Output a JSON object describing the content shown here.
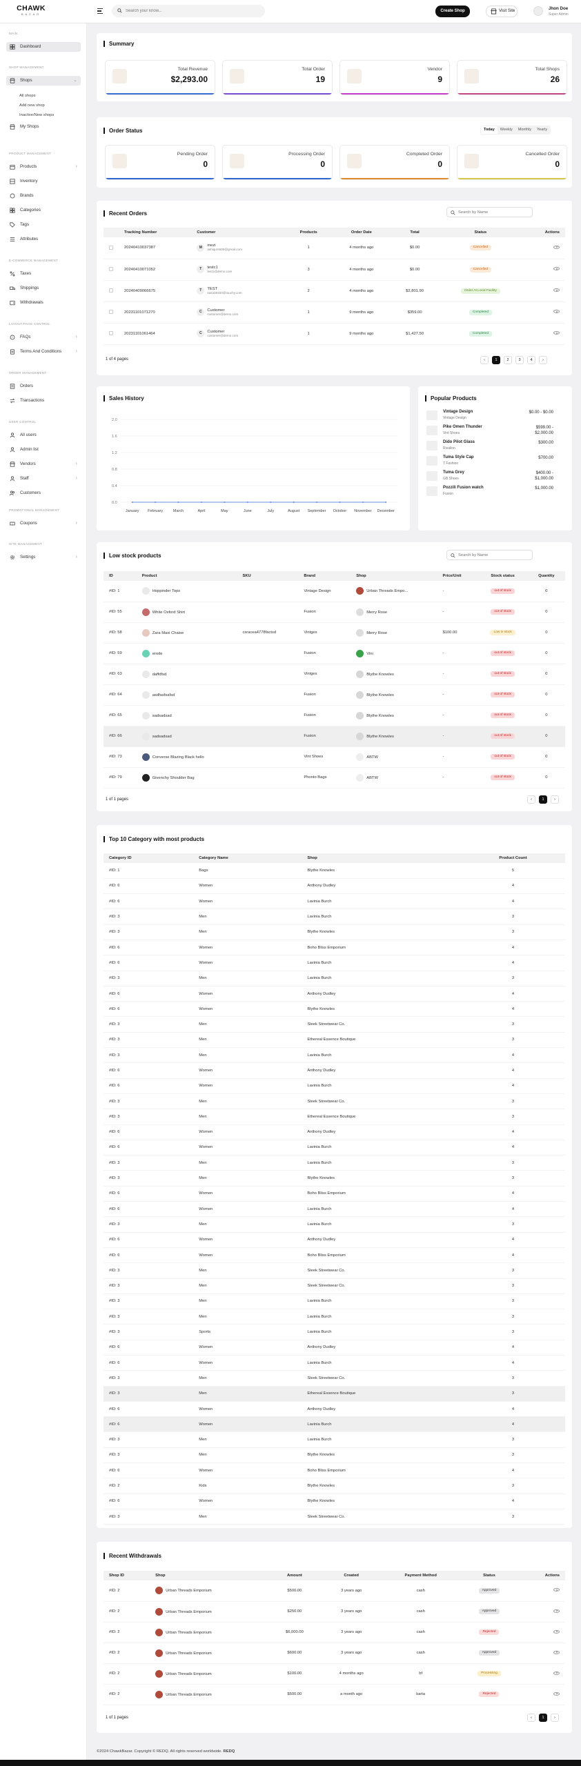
{
  "brand": {
    "name": "CHAWK",
    "tagline": "BAZAR"
  },
  "topbar": {
    "search_placeholder": "Search your know...",
    "create_shop": "Create Shop",
    "visit_site": "Visit Site",
    "user_name": "Jhon Doe",
    "user_role": "Super Admin"
  },
  "sidebar": {
    "sec_main": "MAIN",
    "dashboard": "Dashboard",
    "sec_shop": "SHOP MANAGEMENT",
    "shops": "Shops",
    "all_shops": "All shops",
    "add_new_shop": "Add new shop",
    "inactive_shops": "Inactive/New shops",
    "my_shops": "My Shops",
    "sec_product": "PRODUCT MANAGEMENT",
    "products": "Products",
    "inventory": "Inventory",
    "brands": "Brands",
    "categories": "Categories",
    "tags": "Tags",
    "attributes": "Attributes",
    "sec_ecom": "E-COMMERCE MANAGEMENT",
    "taxes": "Taxes",
    "shippings": "Shippings",
    "withdrawals": "Withdrawals",
    "sec_layout": "LAYOUT/PAGE CONTROL",
    "faqs": "FAQs",
    "terms": "Terms And Conditions",
    "sec_order": "ORDER MANAGEMENT",
    "orders": "Orders",
    "transactions": "Transactions",
    "sec_user": "USER CONTROL",
    "all_users": "All users",
    "admin_list": "Admin list",
    "vendors": "Vendors",
    "staff": "Staff",
    "customers": "Customers",
    "sec_promo": "PROMOTIONAL MANAGEMENT",
    "coupons": "Coupons",
    "sec_site": "SITE MANAGEMENT",
    "settings": "Settings"
  },
  "summary": {
    "title": "Summary",
    "cards": [
      {
        "label": "Total Revenue",
        "value": "$2,293.00",
        "color": "#3b6fd6"
      },
      {
        "label": "Total Order",
        "value": "19",
        "color": "#7b4fd6"
      },
      {
        "label": "Vendor",
        "value": "9",
        "color": "#c83fc9"
      },
      {
        "label": "Total Shops",
        "value": "26",
        "color": "#c64a8a"
      }
    ]
  },
  "order_status": {
    "title": "Order Status",
    "tabs": [
      "Today",
      "Weekly",
      "Monthly",
      "Yearly"
    ],
    "cards": [
      {
        "label": "Pending Order",
        "value": "0",
        "color": "#2f66d0"
      },
      {
        "label": "Processing Order",
        "value": "0",
        "color": "#2f66d0"
      },
      {
        "label": "Completed Order",
        "value": "0",
        "color": "#e08a2c"
      },
      {
        "label": "Cancelled Order",
        "value": "0",
        "color": "#d8c94a"
      }
    ]
  },
  "recent_orders": {
    "title": "Recent Orders",
    "search_placeholder": "Search by Name",
    "headers": [
      "Tracking Number",
      "Customer",
      "Products",
      "Order Date",
      "Total",
      "Status",
      "Actions"
    ],
    "rows": [
      {
        "tracking": "20240410037387",
        "initial": "M",
        "name": "mezi",
        "email": "ashiqurs500@gmail.com",
        "products": "1",
        "date": "4 months ago",
        "total": "$0.00",
        "status": "Cancelled",
        "st": "cancel"
      },
      {
        "tracking": "20240410071052",
        "initial": "T",
        "name": "testc1",
        "email": "test1@demo.com",
        "products": "3",
        "date": "4 months ago",
        "total": "$0.00",
        "status": "Cancelled",
        "st": "cancel"
      },
      {
        "tracking": "20240409066675",
        "initial": "T",
        "name": "TEST",
        "email": "sasa35320@touchy.com",
        "products": "2",
        "date": "4 months ago",
        "total": "$2,801.90",
        "status": "Order At Local Facility",
        "st": "atlocal"
      },
      {
        "tracking": "20231101071270",
        "initial": "C",
        "name": "Customer",
        "email": "customer@demo.com",
        "products": "1",
        "date": "9 months ago",
        "total": "$359.00",
        "status": "Completed",
        "st": "complete"
      },
      {
        "tracking": "20231101061464",
        "initial": "C",
        "name": "Customer",
        "email": "customer@demo.com",
        "products": "1",
        "date": "9 months ago",
        "total": "$1,427.50",
        "status": "Completed",
        "st": "complete"
      }
    ],
    "pages_text": "1 of 4 pages",
    "pages": [
      "1",
      "2",
      "3",
      "4"
    ]
  },
  "sales_history": {
    "title": "Sales History"
  },
  "chart_data": {
    "type": "line",
    "title": "Sales History",
    "categories": [
      "January",
      "February",
      "March",
      "April",
      "May",
      "June",
      "July",
      "August",
      "September",
      "October",
      "November",
      "December"
    ],
    "series": [
      {
        "values": [
          0,
          0,
          0,
          0,
          0,
          0,
          0,
          0,
          0,
          0,
          0,
          0
        ]
      }
    ],
    "ylim": [
      0,
      2
    ],
    "yticks": [
      "2.0",
      "1.6",
      "1.2",
      "0.8",
      "0.4",
      "0.0"
    ],
    "grid": true
  },
  "popular_products": {
    "title": "Popular Products",
    "items": [
      {
        "name": "Vintage Design",
        "sub": "Vintage Design",
        "price": "$0.00 - $0.00"
      },
      {
        "name": "Pike Omen Thunder",
        "sub": "Vint Shoes",
        "price": "$599.00 -",
        "price2": "$2,000.00"
      },
      {
        "name": "Dido Pilot Glass",
        "sub": "Rivalion",
        "price": "$300.00"
      },
      {
        "name": "Tuma Style Cap",
        "sub": "T Fashion",
        "price": "$700.00"
      },
      {
        "name": "Tuma Grey",
        "sub": "GB Shoes",
        "price": "$400.00 -",
        "price2": "$1,000.00"
      },
      {
        "name": "Pozzili Fusion watch",
        "sub": "Fusion",
        "price": "$1,000.00"
      }
    ]
  },
  "low_stock": {
    "title": "Low stock products",
    "search_placeholder": "Search by Name",
    "headers": [
      "ID",
      "Product",
      "SKU",
      "Brand",
      "Shop",
      "Price/Unit",
      "Stock status",
      "Quantity"
    ],
    "rows": [
      {
        "id": "#ID: 1",
        "product": "Hoppinder Tops",
        "sku": "",
        "brand": "Vintage Design",
        "shop": "Urban Threads Empo...",
        "price": "-",
        "status": "out of stock",
        "st": "out",
        "qty": "0",
        "shopc": "#b04a3a",
        "thumb": "#e9e9e9"
      },
      {
        "id": "#ID: 55",
        "product": "White Oxford Shirt",
        "sku": "",
        "brand": "Fusion",
        "shop": "Merry Rose",
        "price": "-",
        "status": "out of stock",
        "st": "out",
        "qty": "0",
        "shopc": "#ddd",
        "thumb": "#c56a6a"
      },
      {
        "id": "#ID: 58",
        "product": "Zara Maxi Chaise",
        "sku": "csracea4778factsd",
        "brand": "Vintges",
        "shop": "Merry Rose",
        "price": "$100.00",
        "status": "Low in stock",
        "st": "low",
        "qty": "0",
        "shopc": "#ddd",
        "thumb": "#e6c9c0"
      },
      {
        "id": "#ID: 59",
        "product": "erode",
        "sku": "",
        "brand": "Fusion",
        "shop": "Vini",
        "price": "-",
        "status": "out of stock",
        "st": "out",
        "qty": "0",
        "shopc": "#3aa34a",
        "thumb": "#6ad3b5"
      },
      {
        "id": "#ID: 63",
        "product": "daffdfsd",
        "sku": "",
        "brand": "Vintges",
        "shop": "Blythe Knowles",
        "price": "-",
        "status": "out of stock",
        "st": "out",
        "qty": "0",
        "shopc": "#d7d7d7",
        "thumb": "#e9e9e9"
      },
      {
        "id": "#ID: 64",
        "product": "asdfasfsafsd",
        "sku": "",
        "brand": "Fusion",
        "shop": "Blythe Knowles",
        "price": "-",
        "status": "out of stock",
        "st": "out",
        "qty": "0",
        "shopc": "#d7d7d7",
        "thumb": "#e9e9e9"
      },
      {
        "id": "#ID: 65",
        "product": "sadsadsad",
        "sku": "",
        "brand": "Fusion",
        "shop": "Blythe Knowles",
        "price": "-",
        "status": "out of stock",
        "st": "out",
        "qty": "0",
        "shopc": "#d7d7d7",
        "thumb": "#e9e9e9"
      },
      {
        "id": "#ID: 66",
        "product": "sadsadsad",
        "sku": "",
        "brand": "Fusion",
        "shop": "Blythe Knowles",
        "price": "-",
        "status": "out of stock",
        "st": "out",
        "qty": "0",
        "shopc": "#d7d7d7",
        "thumb": "#e9e9e9"
      },
      {
        "id": "#ID: 73",
        "product": "Converse Blazing Black hello",
        "sku": "",
        "brand": "Vint Shoes",
        "shop": "ABTW",
        "price": "-",
        "status": "out of stock",
        "st": "out",
        "qty": "0",
        "shopc": "#eee",
        "thumb": "#4a5a7a"
      },
      {
        "id": "#ID: 79",
        "product": "Givenchy Shoulder Bag",
        "sku": "",
        "brand": "Phonto Bags",
        "shop": "ABTW",
        "price": "-",
        "status": "out of stock",
        "st": "out",
        "qty": "0",
        "shopc": "#eee",
        "thumb": "#222"
      }
    ],
    "pages_text": "1 of 1 pages"
  },
  "top_category": {
    "title": "Top 10 Category with most products",
    "headers": [
      "Category ID",
      "Category Name",
      "Shop",
      "Product Count"
    ],
    "rows": [
      [
        "#ID: 1",
        "Bags",
        "Blythe Knowles",
        "5"
      ],
      [
        "#ID: 6",
        "Women",
        "Anthony Dudley",
        "4"
      ],
      [
        "#ID: 6",
        "Women",
        "Lavinia Burch",
        "4"
      ],
      [
        "#ID: 3",
        "Men",
        "Lavinia Burch",
        "3"
      ],
      [
        "#ID: 3",
        "Men",
        "Blythe Knowles",
        "3"
      ],
      [
        "#ID: 6",
        "Women",
        "Boho Bliss Emporium",
        "4"
      ],
      [
        "#ID: 6",
        "Women",
        "Lavinia Burch",
        "4"
      ],
      [
        "#ID: 3",
        "Men",
        "Lavinia Burch",
        "3"
      ],
      [
        "#ID: 6",
        "Women",
        "Anthony Dudley",
        "4"
      ],
      [
        "#ID: 6",
        "Women",
        "Blythe Knowles",
        "4"
      ],
      [
        "#ID: 3",
        "Men",
        "Sleek Streetwear Co.",
        "3"
      ],
      [
        "#ID: 3",
        "Men",
        "Ethereal Essence Boutique",
        "3"
      ],
      [
        "#ID: 3",
        "Men",
        "Lavinia Burch",
        "4"
      ],
      [
        "#ID: 6",
        "Women",
        "Anthony Dudley",
        "4"
      ],
      [
        "#ID: 6",
        "Women",
        "Lavinia Burch",
        "4"
      ],
      [
        "#ID: 3",
        "Men",
        "Sleek Streetwear Co.",
        "3"
      ],
      [
        "#ID: 3",
        "Men",
        "Ethereal Essence Boutique",
        "3"
      ],
      [
        "#ID: 6",
        "Women",
        "Anthony Dudley",
        "4"
      ],
      [
        "#ID: 6",
        "Women",
        "Lavinia Burch",
        "4"
      ],
      [
        "#ID: 3",
        "Men",
        "Lavinia Burch",
        "3"
      ],
      [
        "#ID: 3",
        "Men",
        "Blythe Knowles",
        "3"
      ],
      [
        "#ID: 6",
        "Women",
        "Boho Bliss Emporium",
        "4"
      ],
      [
        "#ID: 6",
        "Women",
        "Lavinia Burch",
        "4"
      ],
      [
        "#ID: 3",
        "Men",
        "Lavinia Burch",
        "3"
      ],
      [
        "#ID: 6",
        "Women",
        "Anthony Dudley",
        "4"
      ],
      [
        "#ID: 6",
        "Women",
        "Boho Bliss Emporium",
        "4"
      ],
      [
        "#ID: 3",
        "Men",
        "Sleek Streetwear Co.",
        "3"
      ],
      [
        "#ID: 3",
        "Men",
        "Sleek Streetwear Co.",
        "3"
      ],
      [
        "#ID: 3",
        "Men",
        "Lavinia Burch",
        "3"
      ],
      [
        "#ID: 3",
        "Men",
        "Lavinia Burch",
        "3"
      ],
      [
        "#ID: 3",
        "Sports",
        "Lavinia Burch",
        "3"
      ],
      [
        "#ID: 6",
        "Women",
        "Anthony Dudley",
        "4"
      ],
      [
        "#ID: 6",
        "Women",
        "Lavinia Burch",
        "4"
      ],
      [
        "#ID: 3",
        "Men",
        "Sleek Streetwear Co.",
        "3"
      ],
      [
        "#ID: 3",
        "Men",
        "Ethereal Essence Boutique",
        "3"
      ],
      [
        "#ID: 6",
        "Women",
        "Anthony Dudley",
        "4"
      ],
      [
        "#ID: 6",
        "Women",
        "Lavinia Burch",
        "4"
      ],
      [
        "#ID: 3",
        "Men",
        "Lavinia Burch",
        "3"
      ],
      [
        "#ID: 3",
        "Men",
        "Blythe Knowles",
        "3"
      ],
      [
        "#ID: 6",
        "Women",
        "Boho Bliss Emporium",
        "4"
      ],
      [
        "#ID: 2",
        "Kids",
        "Blythe Knowles",
        "3"
      ],
      [
        "#ID: 6",
        "Women",
        "Blythe Knowles",
        "4"
      ],
      [
        "#ID: 3",
        "Men",
        "Sleek Streetwear Co.",
        "3"
      ]
    ]
  },
  "withdrawals": {
    "title": "Recent Withdrawals",
    "headers": [
      "Shop ID",
      "Shop",
      "Amount",
      "Created",
      "Payment Method",
      "Status",
      "Actions"
    ],
    "rows": [
      {
        "id": "#ID: 2",
        "shop": "Urban Threads Emporium",
        "amount": "$500.00",
        "created": "3 years ago",
        "method": "cash",
        "status": "Approved",
        "st": "approved"
      },
      {
        "id": "#ID: 2",
        "shop": "Urban Threads Emporium",
        "amount": "$250.00",
        "created": "3 years ago",
        "method": "cash",
        "status": "Approved",
        "st": "approved"
      },
      {
        "id": "#ID: 2",
        "shop": "Urban Threads Emporium",
        "amount": "$6,000.00",
        "created": "3 years ago",
        "method": "cash",
        "status": "Rejected",
        "st": "rejected"
      },
      {
        "id": "#ID: 2",
        "shop": "Urban Threads Emporium",
        "amount": "$600.00",
        "created": "3 years ago",
        "method": "cash",
        "status": "Approved",
        "st": "approved"
      },
      {
        "id": "#ID: 2",
        "shop": "Urban Threads Emporium",
        "amount": "$100.00",
        "created": "4 months ago",
        "method": "bf",
        "status": "Processing",
        "st": "processing"
      },
      {
        "id": "#ID: 2",
        "shop": "Urban Threads Emporium",
        "amount": "$500.00",
        "created": "a month ago",
        "method": "karta",
        "status": "Rejected",
        "st": "rejected"
      }
    ],
    "pages_text": "1 of 1 pages"
  },
  "footer": {
    "text": "©2024 ChawkBazar. Copyright © REDQ. All rights reserved worldwide.",
    "brand": "REDQ"
  }
}
